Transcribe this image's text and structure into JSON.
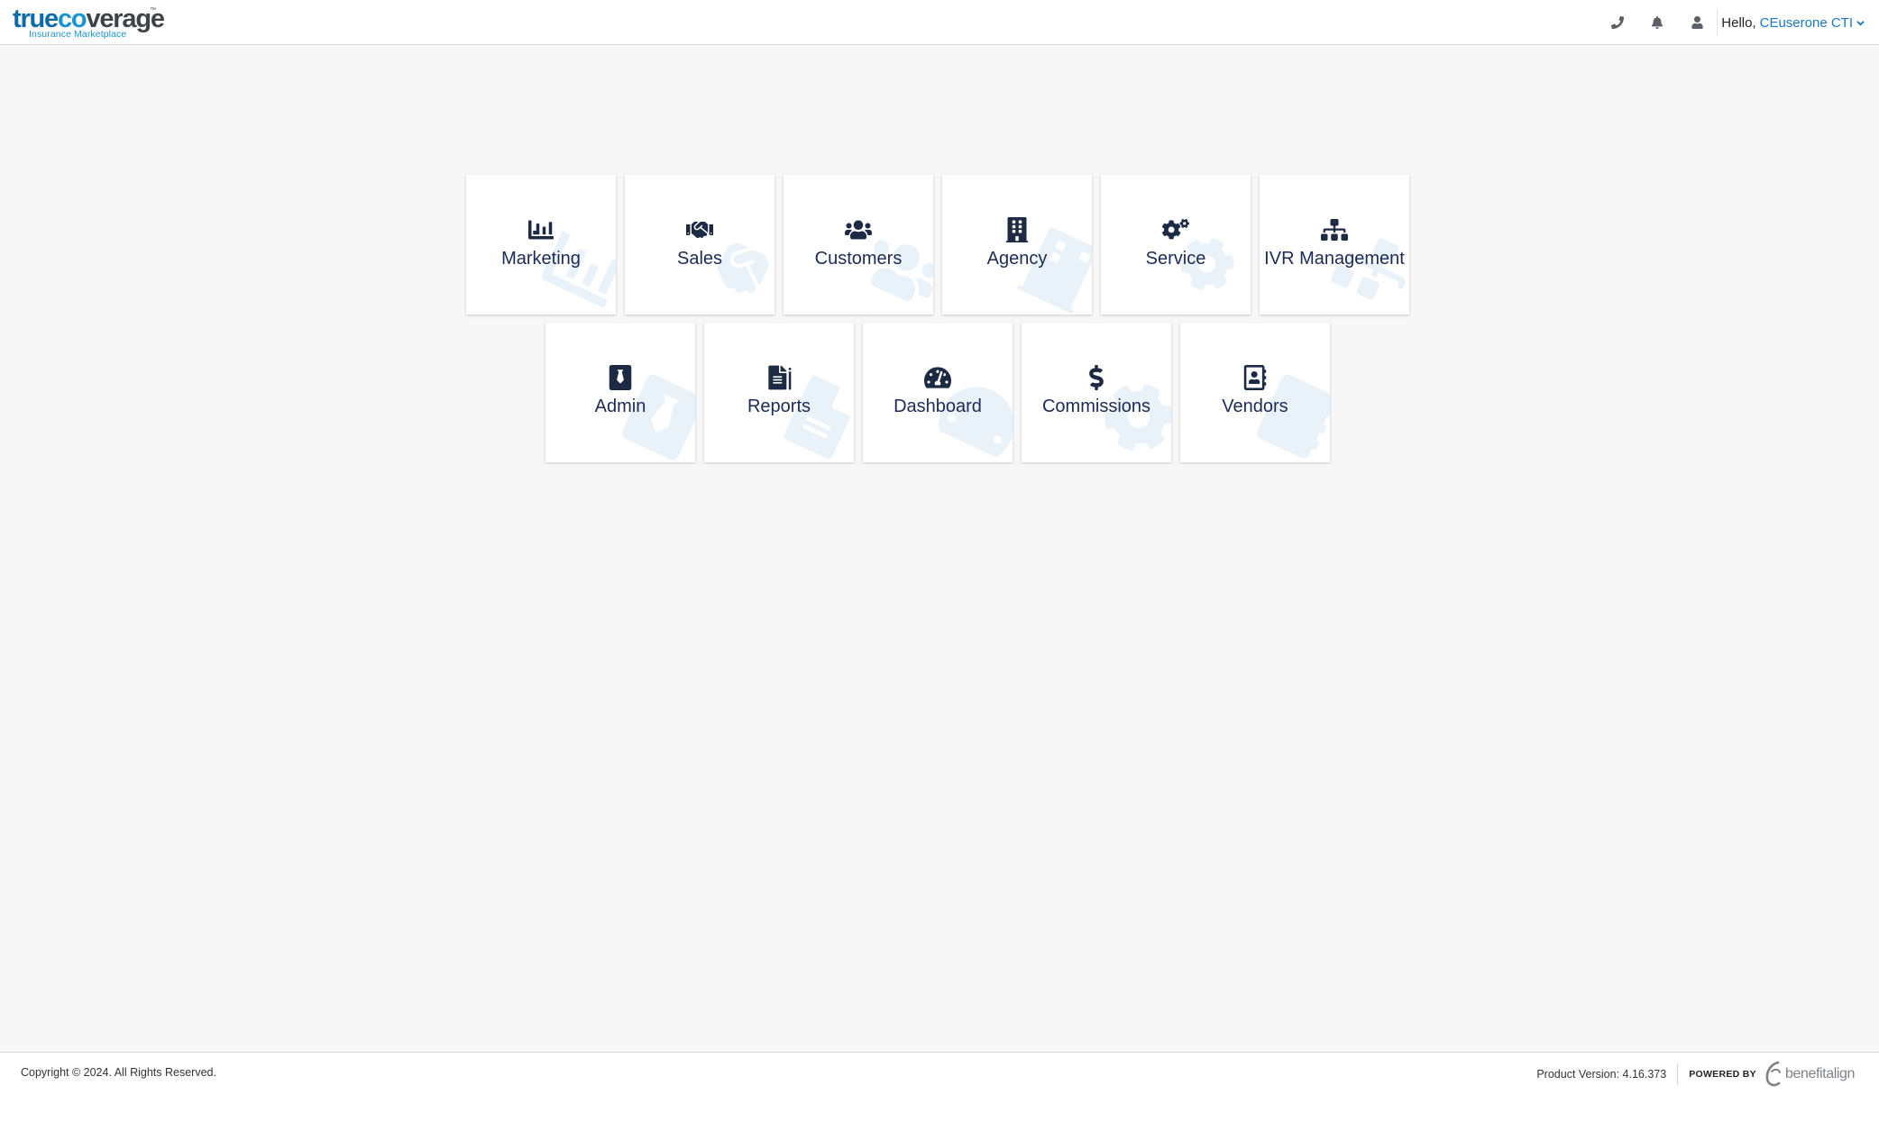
{
  "header": {
    "logo": {
      "part1": "true",
      "part2": "co",
      "part3": "verage",
      "trademark": "™",
      "subtitle": "Insurance Marketplace"
    },
    "phone_icon": "phone-icon",
    "bell_icon": "bell-icon",
    "user_icon": "user-icon",
    "greeting": "Hello,",
    "user_name": "CEuserone CTI"
  },
  "tiles_row1": [
    {
      "label": "Marketing",
      "icon": "bar-chart-icon"
    },
    {
      "label": "Sales",
      "icon": "handshake-icon"
    },
    {
      "label": "Customers",
      "icon": "users-icon"
    },
    {
      "label": "Agency",
      "icon": "building-icon"
    },
    {
      "label": "Service",
      "icon": "gears-icon"
    },
    {
      "label": "IVR Management",
      "icon": "sitemap-icon"
    }
  ],
  "tiles_row2": [
    {
      "label": "Admin",
      "icon": "admin-badge-icon"
    },
    {
      "label": "Reports",
      "icon": "file-report-icon"
    },
    {
      "label": "Dashboard",
      "icon": "gauge-icon"
    },
    {
      "label": "Commissions",
      "icon": "dollar-icon"
    },
    {
      "label": "Vendors",
      "icon": "address-book-icon"
    }
  ],
  "footer": {
    "copyright": "Copyright © 2024. All Rights Reserved.",
    "version": "Product Version: 4.16.373",
    "powered_by": "POWERED BY",
    "brand": "benefitalign"
  },
  "colors": {
    "tile_text": "#1c2a55",
    "link": "#1b78c6",
    "logo_dark_blue": "#0d6aa8",
    "logo_light_blue": "#1c94d2"
  }
}
